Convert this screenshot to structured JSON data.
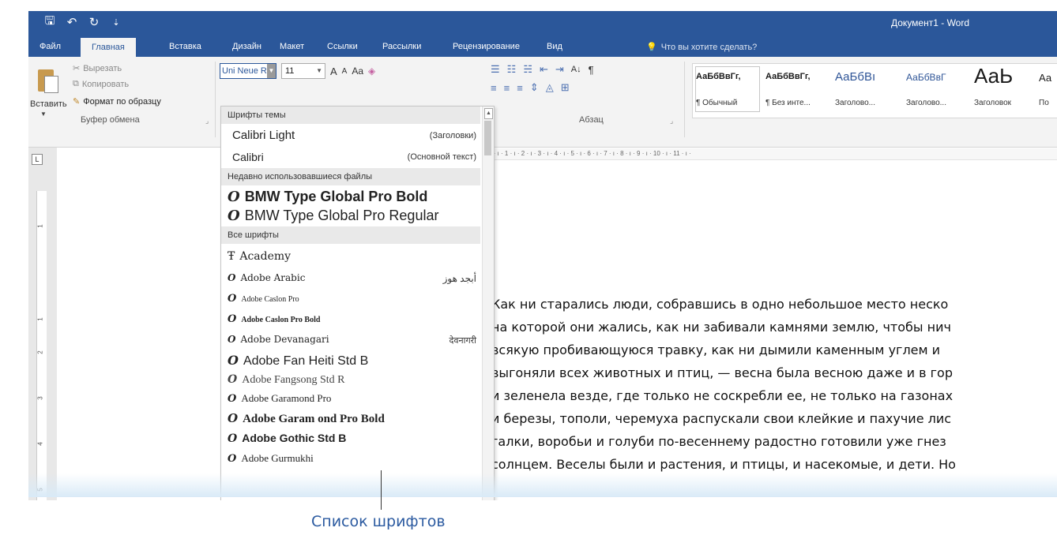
{
  "window": {
    "title": "Документ1 - Word",
    "accent": "#2b579a"
  },
  "quick_access": [
    {
      "name": "save-icon",
      "glyph": "🖫"
    },
    {
      "name": "undo-icon",
      "glyph": "↶"
    },
    {
      "name": "redo-icon",
      "glyph": "↻"
    },
    {
      "name": "customize-qat-icon",
      "glyph": "⇣"
    }
  ],
  "tabs": [
    {
      "label": "Файл"
    },
    {
      "label": "Главная",
      "active": true
    },
    {
      "label": "Вставка"
    },
    {
      "label": "Дизайн"
    },
    {
      "label": "Макет"
    },
    {
      "label": "Ссылки"
    },
    {
      "label": "Рассылки"
    },
    {
      "label": "Рецензирование"
    },
    {
      "label": "Вид"
    }
  ],
  "tell_me": {
    "placeholder": "Что вы хотите сделать?"
  },
  "clipboard": {
    "paste": "Вставить",
    "cut": "Вырезать",
    "copy": "Копировать",
    "format_painter": "Формат по образцу",
    "group_label": "Буфер обмена"
  },
  "font": {
    "name": "Uni Neue Re",
    "size": "11",
    "grow": "A",
    "shrink": "A",
    "case": "Aa"
  },
  "paragraph": {
    "group_label": "Абзац",
    "sort": "А↓",
    "pilcrow": "¶"
  },
  "styles": [
    {
      "sample": "АаБбВвГг,",
      "name": "¶ Обычный"
    },
    {
      "sample": "АаБбВвГг,",
      "name": "¶ Без инте..."
    },
    {
      "sample": "АаБбВı",
      "name": "Заголово..."
    },
    {
      "sample": "АаБбВвГ",
      "name": "Заголово..."
    },
    {
      "sample": "АаЬ",
      "name": "Заголовок"
    },
    {
      "sample": "Аа",
      "name": "По"
    }
  ],
  "ruler": {
    "text": "1 · ı · 1 · ı · 2 · ı · 3 · ı · 4 · ı · 5 · ı · 6 · ı · 7 · ı · 8 · ı · 9 · ı · 10 · ı · 11 · ı ·"
  },
  "left_ruler": {
    "marker": "L",
    "numbers": [
      "1",
      "1",
      "2",
      "3",
      "4",
      "5"
    ]
  },
  "font_dropdown": {
    "theme_fonts_header": "Шрифты темы",
    "theme_fonts": [
      {
        "name": "Calibri Light",
        "tag": "(Заголовки)"
      },
      {
        "name": "Calibri",
        "tag": "(Основной текст)"
      }
    ],
    "recent_header": "Недавно использовавшиеся файлы",
    "recent": [
      {
        "prefix": "O",
        "name": "BMW Type Global Pro Bold"
      },
      {
        "prefix": "O",
        "name": "BMW Type Global Pro Regular"
      }
    ],
    "all_header": "Все шрифты",
    "all": [
      {
        "prefix": "Ŧ",
        "name": "Academy",
        "tag": ""
      },
      {
        "prefix": "O",
        "name": "Adobe Arabic",
        "tag": "أبجد هوز"
      },
      {
        "prefix": "O",
        "name": "Adobe Caslon Pro",
        "tag": ""
      },
      {
        "prefix": "O",
        "name": "Adobe Caslon Pro Bold",
        "tag": ""
      },
      {
        "prefix": "O",
        "name": "Adobe Devanagari",
        "tag": "देवनागरी"
      },
      {
        "prefix": "O",
        "name": "Adobe Fan Heiti Std B",
        "tag": ""
      },
      {
        "prefix": "O",
        "name": "Adobe Fangsong Std R",
        "tag": ""
      },
      {
        "prefix": "O",
        "name": "Adobe Garamond Pro",
        "tag": ""
      },
      {
        "prefix": "O",
        "name": "Adobe Garam ond Pro Bold",
        "tag": ""
      },
      {
        "prefix": "O",
        "name": "Adobe Gothic Std B",
        "tag": ""
      },
      {
        "prefix": "O",
        "name": "Adobe Gurmukhi",
        "tag": ""
      }
    ]
  },
  "document": {
    "lines": [
      "Как ни старались люди, собравшись в одно небольшое место неско",
      "на которой они жались, как ни забивали камнями землю, чтобы нич",
      "всякую пробивающуюся травку, как ни дымили каменным углем и",
      "выгоняли всех животных и птиц, — весна была весною даже и в гор",
      "и зеленела везде, где только не соскребли ее, не только на газонах",
      "и березы, тополи, черемуха распускали свои клейкие и пахучие лис",
      "галки, воробьи и голуби по-весеннему радостно готовили уже гнез",
      "солнцем. Веселы были и растения, и птицы, и насекомые, и дети. Но"
    ]
  },
  "callout": {
    "label": "Список шрифтов"
  }
}
